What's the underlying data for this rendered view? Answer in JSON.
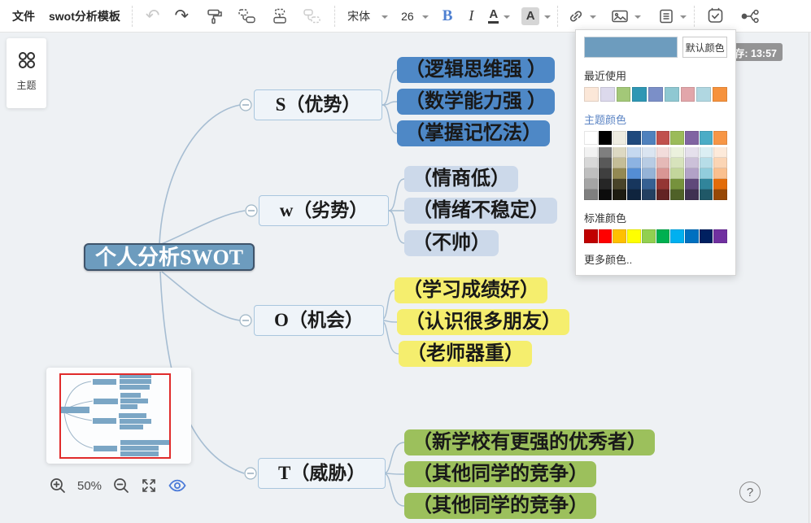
{
  "toolbar": {
    "file_menu": "文件",
    "doc_title": "swot分析模板",
    "font_family": "宋体",
    "font_size": "26",
    "bold_label": "B",
    "italic_label": "I",
    "font_color_label": "A",
    "highlight_label": "A"
  },
  "theme_panel": {
    "label": "主题"
  },
  "mindmap": {
    "root": {
      "label": "个人分析SWOT",
      "bg": "#6d9cbe"
    },
    "branches": [
      {
        "label": "S（优势）",
        "child_bg": "#4e88c6",
        "children": [
          "（逻辑思维强 ）",
          "（数学能力强 ）",
          "（掌握记忆法）"
        ]
      },
      {
        "label": "w（劣势）",
        "child_bg": "#ccd9ea",
        "children": [
          "（情商低）",
          "（情绪不稳定）",
          "（不帅）"
        ]
      },
      {
        "label": "O（机会）",
        "child_bg": "#f5ee6e",
        "children": [
          "（学习成绩好）",
          "（认识很多朋友）",
          "（老师器重）"
        ]
      },
      {
        "label": "T（威胁）",
        "child_bg": "#9cc05c",
        "children": [
          "（新学校有更强的优秀者）",
          "（其他同学的竞争）",
          "（其他同学的竞争）"
        ]
      }
    ]
  },
  "color_picker": {
    "current_color": "#6d9cbe",
    "default_button_label": "默认颜色",
    "recent_label": "最近使用",
    "recent_colors": [
      "#fbe7d8",
      "#dcd9ec",
      "#a3c878",
      "#2f97b4",
      "#7b8fc8",
      "#8fc8d2",
      "#e2a6aa",
      "#b0d7e1",
      "#f6923d"
    ],
    "theme_label": "主题颜色",
    "theme_colors": [
      [
        "#ffffff",
        "#000000",
        "#eeece1",
        "#1f497d",
        "#4f81bd",
        "#c0504d",
        "#9bbb59",
        "#8064a2",
        "#4bacc6",
        "#f79646"
      ],
      [
        "#f2f2f2",
        "#7f7f7f",
        "#ddd9c3",
        "#c6d9f0",
        "#dbe5f1",
        "#f2dcdb",
        "#ebf1dd",
        "#e5e0ec",
        "#dbeef3",
        "#fdeada"
      ],
      [
        "#d8d8d8",
        "#595959",
        "#c4bd97",
        "#8db3e2",
        "#b8cce4",
        "#e5b9b7",
        "#d7e3bc",
        "#ccc1d9",
        "#b7dde8",
        "#fbd5b5"
      ],
      [
        "#bfbfbf",
        "#3f3f3f",
        "#938953",
        "#548dd4",
        "#95b3d7",
        "#d99694",
        "#c3d69b",
        "#b2a2c7",
        "#92cddc",
        "#fac08f"
      ],
      [
        "#a5a5a5",
        "#262626",
        "#494429",
        "#17365d",
        "#366092",
        "#943634",
        "#76923c",
        "#5f497a",
        "#31859b",
        "#e36c09"
      ],
      [
        "#7f7f7f",
        "#0c0c0c",
        "#1d1b10",
        "#0f243e",
        "#244061",
        "#632423",
        "#4f6128",
        "#3f3151",
        "#205867",
        "#974806"
      ]
    ],
    "standard_label": "标准颜色",
    "standard_colors": [
      "#c00000",
      "#ff0000",
      "#ffc000",
      "#ffff00",
      "#92d050",
      "#00b050",
      "#00b0f0",
      "#0070c0",
      "#002060",
      "#7030a0"
    ],
    "more_label": "更多颜色.."
  },
  "minimap": {
    "zoom_level": "50%"
  },
  "autosave_toast": {
    "text": "存: 13:57"
  },
  "help": {
    "label": "?"
  }
}
